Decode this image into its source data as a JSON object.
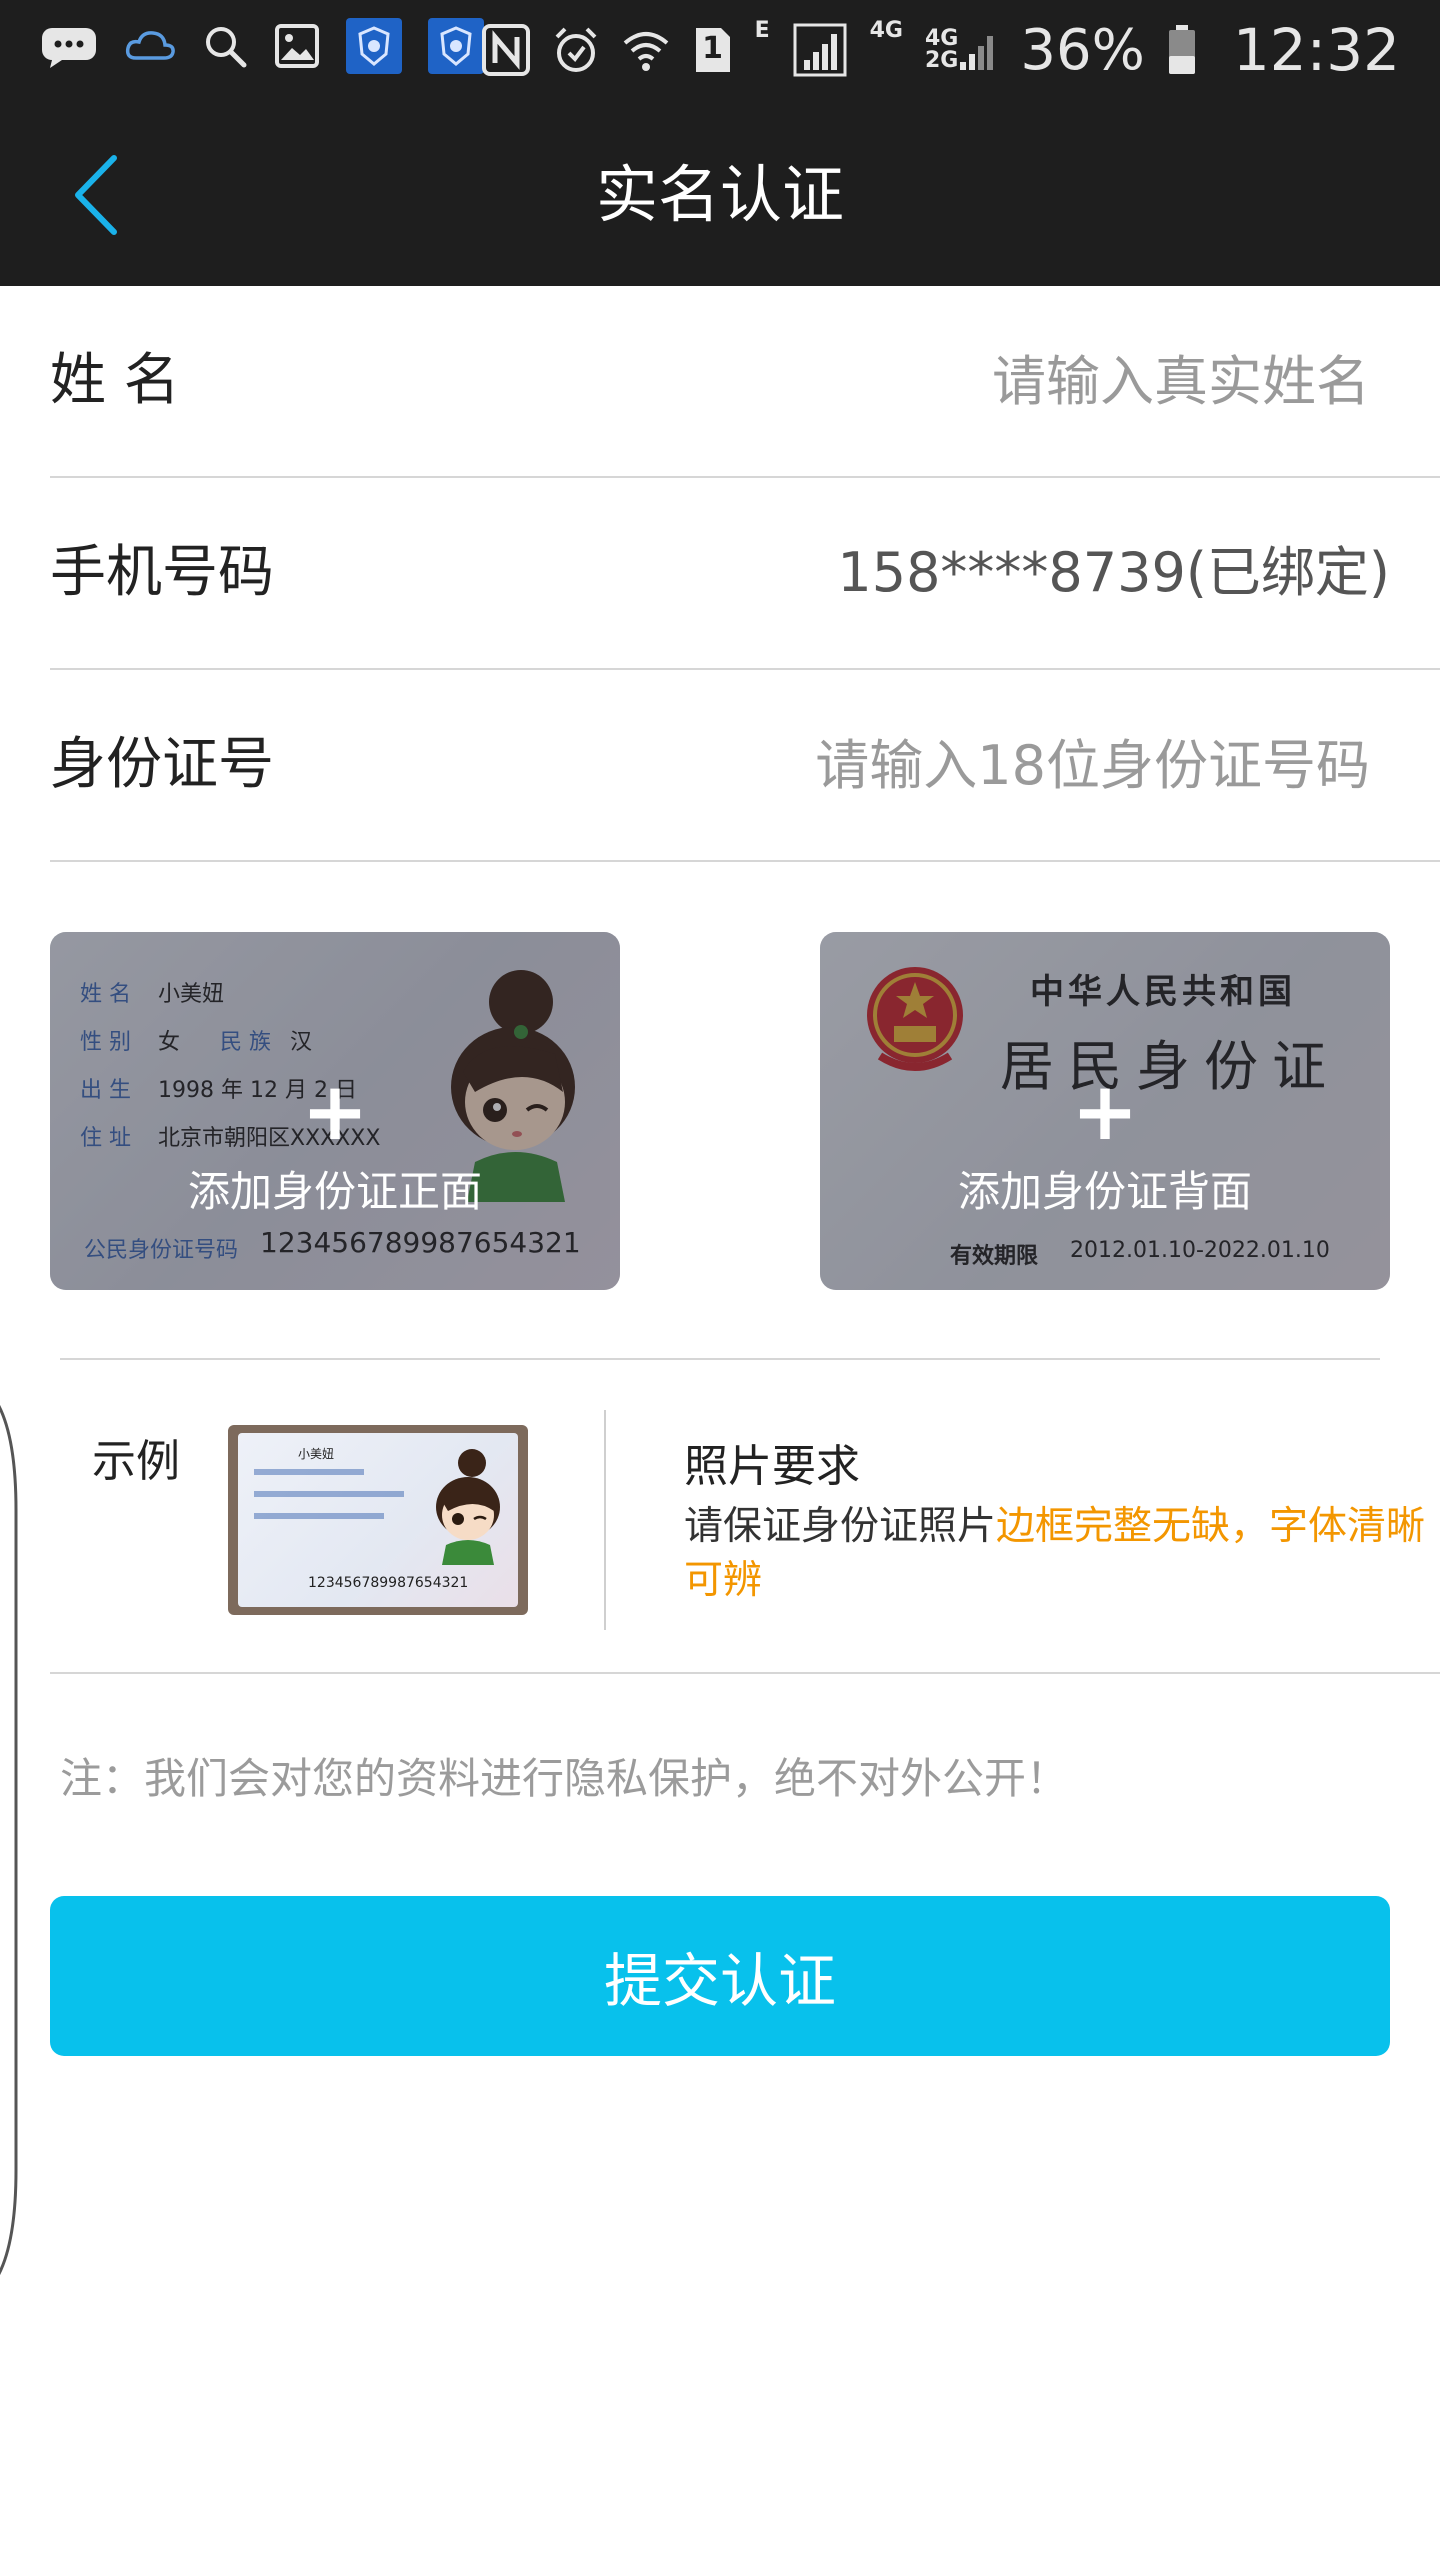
{
  "status_bar": {
    "icons_left": [
      "chat-icon",
      "cloud-icon",
      "search-icon",
      "image-icon",
      "app-badge-icon",
      "app-badge-icon"
    ],
    "icons_right": [
      "nfc-icon",
      "alarm-icon",
      "wifi-icon",
      "sim-icon",
      "signal-icon"
    ],
    "sim_slot": "1",
    "network_e": "E",
    "network_4g": "4G",
    "network_4g2g_top": "4G",
    "network_4g2g_bottom": "2G",
    "battery_percent": "36%",
    "time": "12:32"
  },
  "header": {
    "title": "实名认证",
    "back_icon": "chevron-left-icon"
  },
  "form": {
    "name": {
      "label": "姓 名",
      "placeholder": "请输入真实姓名"
    },
    "phone": {
      "label": "手机号码",
      "value": "158****8739(已绑定)"
    },
    "id_number": {
      "label": "身份证号",
      "placeholder": "请输入18位身份证号码"
    }
  },
  "upload": {
    "front": {
      "caption": "添加身份证正面",
      "plus": "+",
      "card_name_label": "姓 名",
      "card_name": "小美妞",
      "card_sex_label": "性 别",
      "card_sex": "女",
      "card_ethnic_label": "民 族",
      "card_ethnic": "汉",
      "card_birth_label": "出 生",
      "card_birth": "1998 年 12 月 2 日",
      "card_addr_label": "住 址",
      "card_addr": "北京市朝阳区XXXXXX",
      "card_id_label": "公民身份证号码",
      "card_id": "123456789987654321"
    },
    "back": {
      "caption": "添加身份证背面",
      "plus": "+",
      "country": "中华人民共和国",
      "card_title": "居民身份证",
      "validity_label": "有效期限",
      "validity": "2012.01.10-2022.01.10"
    }
  },
  "example": {
    "label": "示例",
    "thumb_name": "小美妞",
    "thumb_id": "123456789987654321",
    "requirements_title": "照片要求",
    "requirements_text": "请保证身份证照片",
    "requirements_highlight": "边框完整无缺，字体清晰可辨"
  },
  "note": "注：我们会对您的资料进行隐私保护，绝不对外公开！",
  "submit_label": "提交认证",
  "colors": {
    "accent": "#08c1ec",
    "highlight": "#f39600",
    "header_bg": "#1e1e1e"
  }
}
